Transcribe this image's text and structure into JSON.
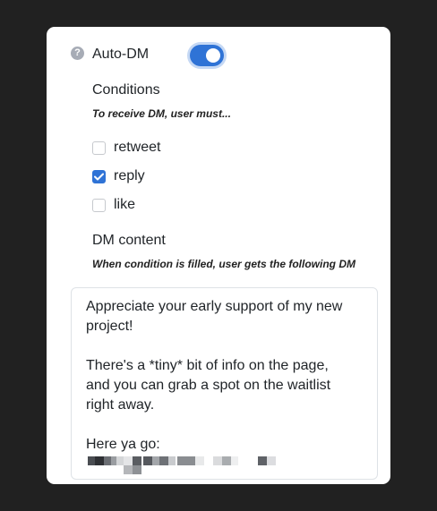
{
  "auto_dm": {
    "label": "Auto-DM",
    "enabled": true,
    "help_icon": "question-circle-icon"
  },
  "conditions": {
    "title": "Conditions",
    "hint": "To receive DM, user must...",
    "options": [
      {
        "label": "retweet",
        "checked": false
      },
      {
        "label": "reply",
        "checked": true
      },
      {
        "label": "like",
        "checked": false
      }
    ]
  },
  "dm_content": {
    "title": "DM content",
    "hint": "When condition is filled, user gets the following DM",
    "lines": [
      "Appreciate your early support of my new",
      "project!",
      "",
      "There's a *tiny* bit of info on the page,",
      "and you can grab a spot on the waitlist",
      "right away.",
      "",
      "Here ya go:"
    ]
  },
  "colors": {
    "accent": "#2f73d6",
    "background": "#212121",
    "card": "#ffffff"
  }
}
